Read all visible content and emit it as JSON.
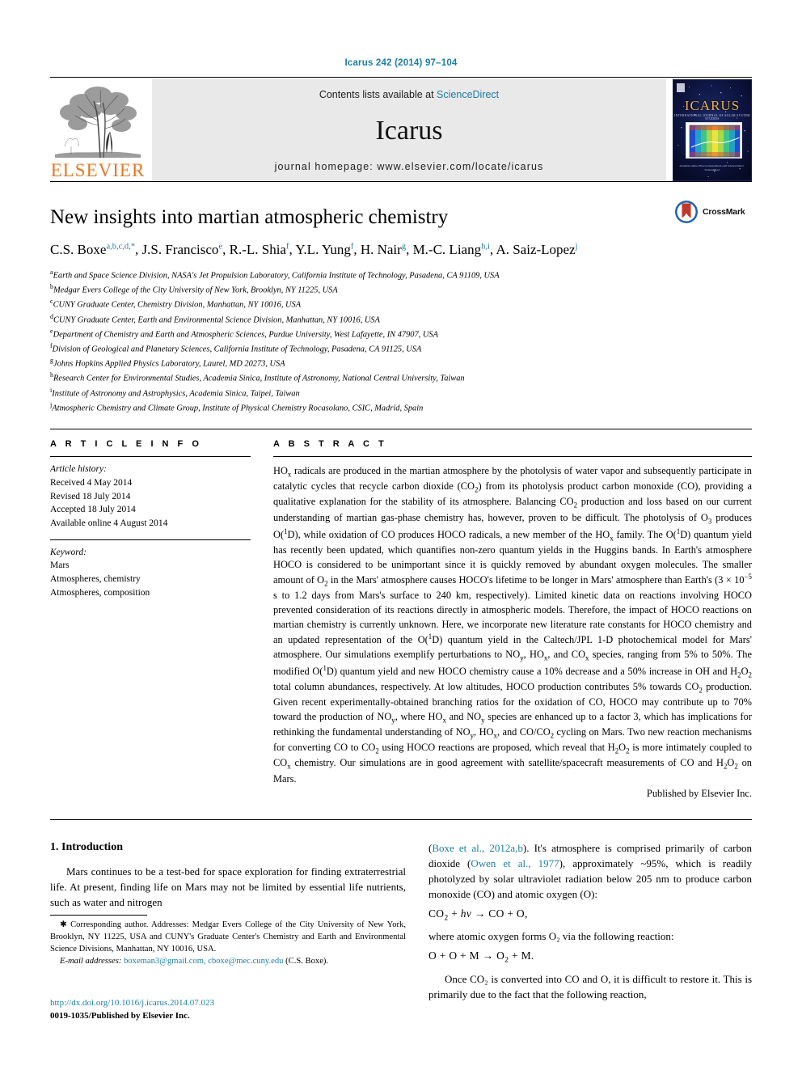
{
  "running_head": "Icarus 242 (2014) 97–104",
  "masthead": {
    "contents_prefix": "Contents lists available at ",
    "sciencedirect": "ScienceDirect",
    "journal_name": "Icarus",
    "homepage": "journal homepage: www.elsevier.com/locate/icarus",
    "publisher_word": "ELSEVIER",
    "cover": {
      "title": "ICARUS",
      "subtitle": "INTERNATIONAL JOURNAL OF SOLAR SYSTEM STUDIES",
      "caption": "Available online at www.sciencedirect.com\nScience Direct · ScienceDirect"
    }
  },
  "article": {
    "title": "New insights into martian atmospheric chemistry",
    "crossmark_label": "CrossMark",
    "authors": [
      {
        "name": "C.S. Boxe",
        "sup": "a,b,c,d,*"
      },
      {
        "name": "J.S. Francisco",
        "sup": "e"
      },
      {
        "name": "R.-L. Shia",
        "sup": "f"
      },
      {
        "name": "Y.L. Yung",
        "sup": "f"
      },
      {
        "name": "H. Nair",
        "sup": "g"
      },
      {
        "name": "M.-C. Liang",
        "sup": "h,i"
      },
      {
        "name": "A. Saiz-Lopez",
        "sup": "j"
      }
    ],
    "affiliations": [
      {
        "marker": "a",
        "text": "Earth and Space Science Division, NASA's Jet Propulsion Laboratory, California Institute of Technology, Pasadena, CA 91109, USA"
      },
      {
        "marker": "b",
        "text": "Medgar Evers College of the City University of New York, Brooklyn, NY 11225, USA"
      },
      {
        "marker": "c",
        "text": "CUNY Graduate Center, Chemistry Division, Manhattan, NY 10016, USA"
      },
      {
        "marker": "d",
        "text": "CUNY Graduate Center, Earth and Environmental Science Division, Manhattan, NY 10016, USA"
      },
      {
        "marker": "e",
        "text": "Department of Chemistry and Earth and Atmospheric Sciences, Purdue University, West Lafayette, IN 47907, USA"
      },
      {
        "marker": "f",
        "text": "Division of Geological and Planetary Sciences, California Institute of Technology, Pasadena, CA 91125, USA"
      },
      {
        "marker": "g",
        "text": "Johns Hopkins Applied Physics Laboratory, Laurel, MD 20273, USA"
      },
      {
        "marker": "h",
        "text": "Research Center for Environmental Studies, Academia Sinica, Institute of Astronomy, National Central University, Taiwan"
      },
      {
        "marker": "i",
        "text": "Institute of Astronomy and Astrophysics, Academia Sinica, Taipei, Taiwan"
      },
      {
        "marker": "j",
        "text": "Atmospheric Chemistry and Climate Group, Institute of Physical Chemistry Rocasolano, CSIC, Madrid, Spain"
      }
    ]
  },
  "info": {
    "heading": "A R T I C L E   I N F O",
    "history_label": "Article history:",
    "history": [
      "Received 4 May 2014",
      "Revised 18 July 2014",
      "Accepted 18 July 2014",
      "Available online 4 August 2014"
    ],
    "keyword_label": "Keyword:",
    "keywords": [
      "Mars",
      "Atmospheres, chemistry",
      "Atmospheres, composition"
    ]
  },
  "abstract": {
    "heading": "A B S T R A C T",
    "publisher_line": "Published by Elsevier Inc."
  },
  "introduction": {
    "heading": "1. Introduction",
    "left_paragraph": "Mars continues to be a test-bed for space exploration for finding extraterrestrial life. At present, finding life on Mars may not be limited by essential life nutrients, such as water and nitrogen",
    "right_ref_1": "Boxe et al., 2012a,b",
    "right_ref_2": "Owen et al., 1977",
    "equation_1": "CO₂ + hν → CO + O,",
    "equation_2": "O + O + M → O₂ + M.",
    "right_after_eq1": "where atomic oxygen forms O₂ via the following reaction:",
    "right_final": "Once CO₂ is converted into CO and O, it is difficult to restore it. This is primarily due to the fact that the following reaction,"
  },
  "footnotes": {
    "corresponding": "Corresponding author. Addresses: Medgar Evers College of the City University of New York, Brooklyn, NY 11225, USA and CUNY's Graduate Center's Chemistry and Earth and Environmental Science Divisions, Manhattan, NY 10016, USA.",
    "email_label": "E-mail addresses:",
    "emails": "boxeman3@gmail.com, cboxe@mec.cuny.edu",
    "email_owner": "(C.S. Boxe).",
    "doi": "http://dx.doi.org/10.1016/j.icarus.2014.07.023",
    "issn": "0019-1035/Published by Elsevier Inc."
  },
  "colors": {
    "link": "#1a7da8",
    "elsevier_orange": "#E87722",
    "band_gray": "#e9e9e9"
  }
}
